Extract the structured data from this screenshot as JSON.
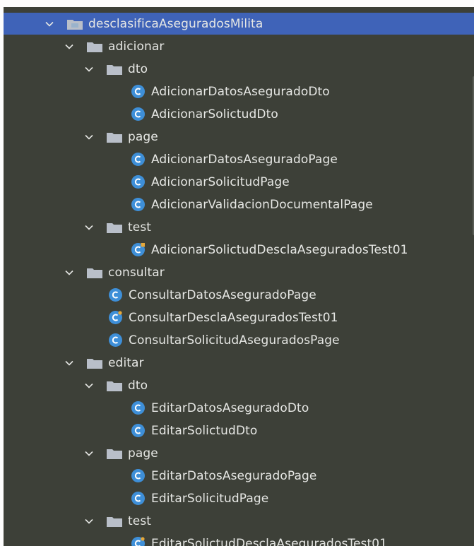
{
  "tree": {
    "root": {
      "label": "desclasificaAseguradosMilita"
    },
    "adicionar": {
      "label": "adicionar",
      "dto": {
        "label": "dto",
        "items": [
          "AdicionarDatosAseguradoDto",
          "AdicionarSolictudDto"
        ]
      },
      "page": {
        "label": "page",
        "items": [
          "AdicionarDatosAseguradoPage",
          "AdicionarSolicitudPage",
          "AdicionarValidacionDocumentalPage"
        ]
      },
      "test": {
        "label": "test",
        "items": [
          "AdicionarSolictudDesclaAseguradosTest01"
        ]
      }
    },
    "consultar": {
      "label": "consultar",
      "items": [
        "ConsultarDatosAseguradoPage",
        "ConsultarDesclaAseguradosTest01",
        "ConsultarSolicitudAseguradosPage"
      ]
    },
    "editar": {
      "label": "editar",
      "dto": {
        "label": "dto",
        "items": [
          "EditarDatosAseguradoDto",
          "EditarSolictudDto"
        ]
      },
      "page": {
        "label": "page",
        "items": [
          "EditarDatosAseguradoPage",
          "EditarSolicitudPage"
        ]
      },
      "test": {
        "label": "test",
        "items": [
          "EditarSolictudDesclaAseguradosTest01"
        ]
      }
    }
  },
  "colors": {
    "background": "#3d4038",
    "selected": "#3f63b8",
    "folder": "#b9bfc9",
    "class_icon": "#3e8fd8",
    "test_marker": "#e5a83b"
  }
}
